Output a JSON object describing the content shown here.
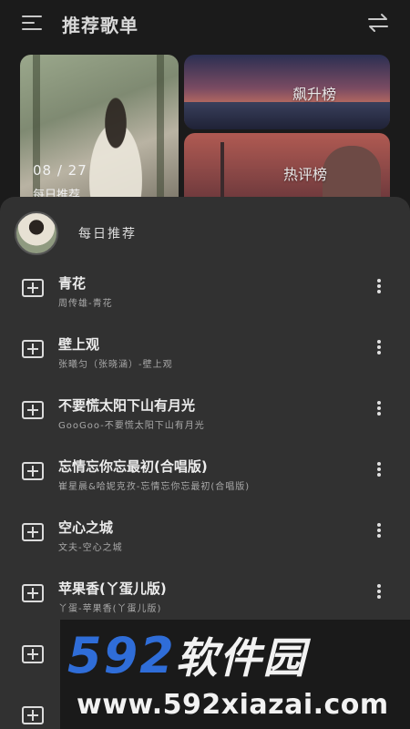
{
  "header": {
    "title": "推荐歌单",
    "menu_icon": "menu-icon",
    "swap_icon": "swap-icon"
  },
  "cards": {
    "daily": {
      "date": "08 / 27",
      "label": "每日推荐"
    },
    "rising": {
      "label": "飙升榜"
    },
    "hot": {
      "label": "热评榜"
    }
  },
  "sheet": {
    "title": "每日推荐",
    "songs": [
      {
        "title": "青花",
        "subtitle": "周传雄-青花"
      },
      {
        "title": "壁上观",
        "subtitle": "张曦匀（张晓涵）-壁上观"
      },
      {
        "title": "不要慌太阳下山有月光",
        "subtitle": "GooGoo-不要慌太阳下山有月光"
      },
      {
        "title": "忘情忘你忘最初(合唱版)",
        "subtitle": "崔星晨&哈妮克孜-忘情忘你忘最初(合唱版)"
      },
      {
        "title": "空心之城",
        "subtitle": "文夫-空心之城"
      },
      {
        "title": "苹果香(丫蛋儿版)",
        "subtitle": "丫蛋-苹果香(丫蛋儿版)"
      }
    ]
  },
  "watermark": {
    "number": "592",
    "brand": "软件园",
    "url": "www.592xiazai.com"
  }
}
